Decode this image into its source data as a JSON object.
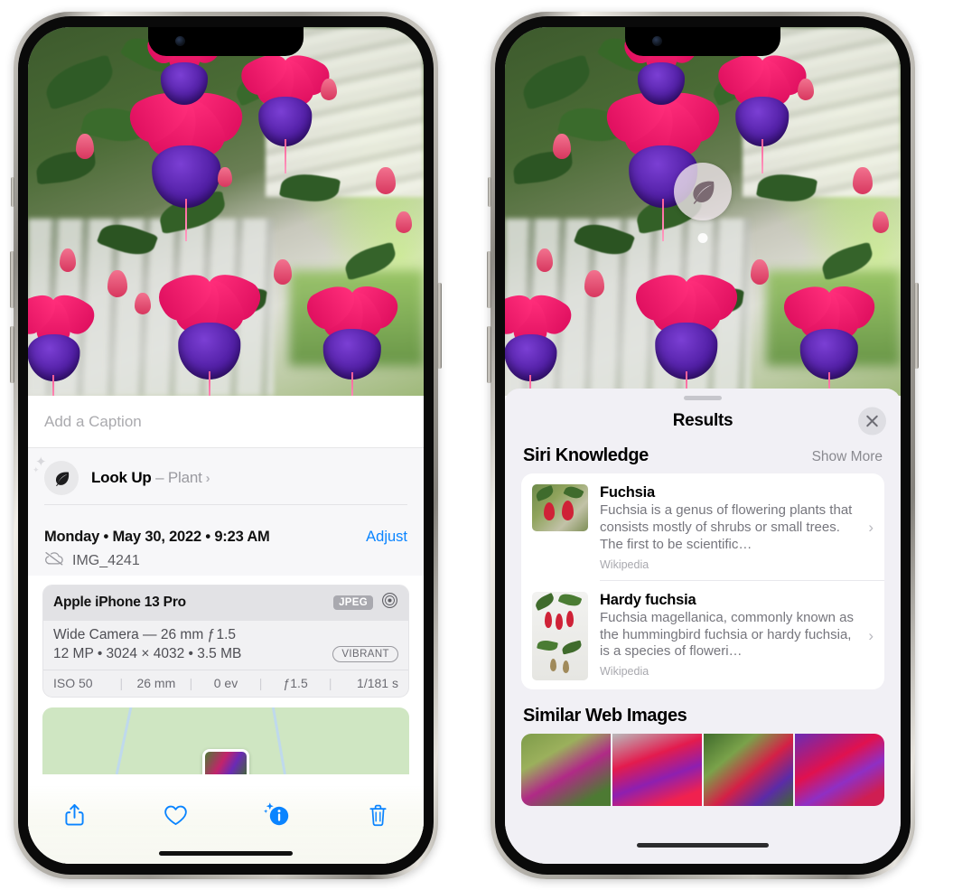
{
  "left_phone": {
    "name": "iphone-photos-info-view",
    "photo": {
      "alt": "fuchsia-flowers-photo"
    },
    "caption": {
      "placeholder": "Add a Caption",
      "value": ""
    },
    "lookup": {
      "icon": "leaf-icon",
      "sparkle": "sparkle-icon",
      "label": "Look Up",
      "separator": " – ",
      "subject": "Plant",
      "chevron": "›"
    },
    "meta": {
      "date": "Monday • May 30, 2022 • 9:23 AM",
      "adjust_label": "Adjust",
      "cloud_icon": "cloud-slash-icon",
      "filename": "IMG_4241"
    },
    "camera_card": {
      "model": "Apple iPhone 13 Pro",
      "format_badge": "JPEG",
      "lens_icon": "aperture-icon",
      "lens_line": "Wide Camera — 26 mm ƒ 1.5",
      "specs_line": "12 MP • 3024 × 4032 • 3.5 MB",
      "style_badge": "VIBRANT",
      "exif": [
        "ISO 50",
        "26 mm",
        "0 ev",
        "ƒ1.5",
        "1/181 s"
      ]
    },
    "map": {
      "name": "location-map-strip",
      "pin": "photo-pin"
    },
    "toolbar": {
      "share": "share-icon",
      "favorite": "heart-icon",
      "info": "info-sparkle-icon",
      "delete": "trash-icon"
    }
  },
  "right_phone": {
    "name": "visual-lookup-results-view",
    "photo": {
      "alt": "fuchsia-flowers-photo"
    },
    "badge": {
      "icon": "leaf-icon",
      "dot": "lookup-anchor-dot"
    },
    "sheet": {
      "grabber": "sheet-grabber",
      "title": "Results",
      "close_icon": "close-icon",
      "sections": [
        {
          "title": "Siri Knowledge",
          "action": "Show More",
          "items": [
            {
              "name": "Fuchsia",
              "description": "Fuchsia is a genus of flowering plants that consists mostly of shrubs or small trees. The first to be scientific…",
              "source": "Wikipedia",
              "thumb": "fuchsia-thumbnail",
              "chevron": "›"
            },
            {
              "name": "Hardy fuchsia",
              "description": "Fuchsia magellanica, commonly known as the hummingbird fuchsia or hardy fuchsia, is a species of floweri…",
              "source": "Wikipedia",
              "thumb": "hardy-fuchsia-thumbnail",
              "chevron": "›"
            }
          ]
        },
        {
          "title": "Similar Web Images",
          "action": "",
          "images": [
            "web-image-1",
            "web-image-2",
            "web-image-3",
            "web-image-4"
          ]
        }
      ]
    }
  },
  "colors": {
    "accent_blue": "#0a84ff",
    "sheet_bg": "#f1f0f5",
    "card_bg": "#ffffff",
    "muted_text": "#8a8a90"
  }
}
